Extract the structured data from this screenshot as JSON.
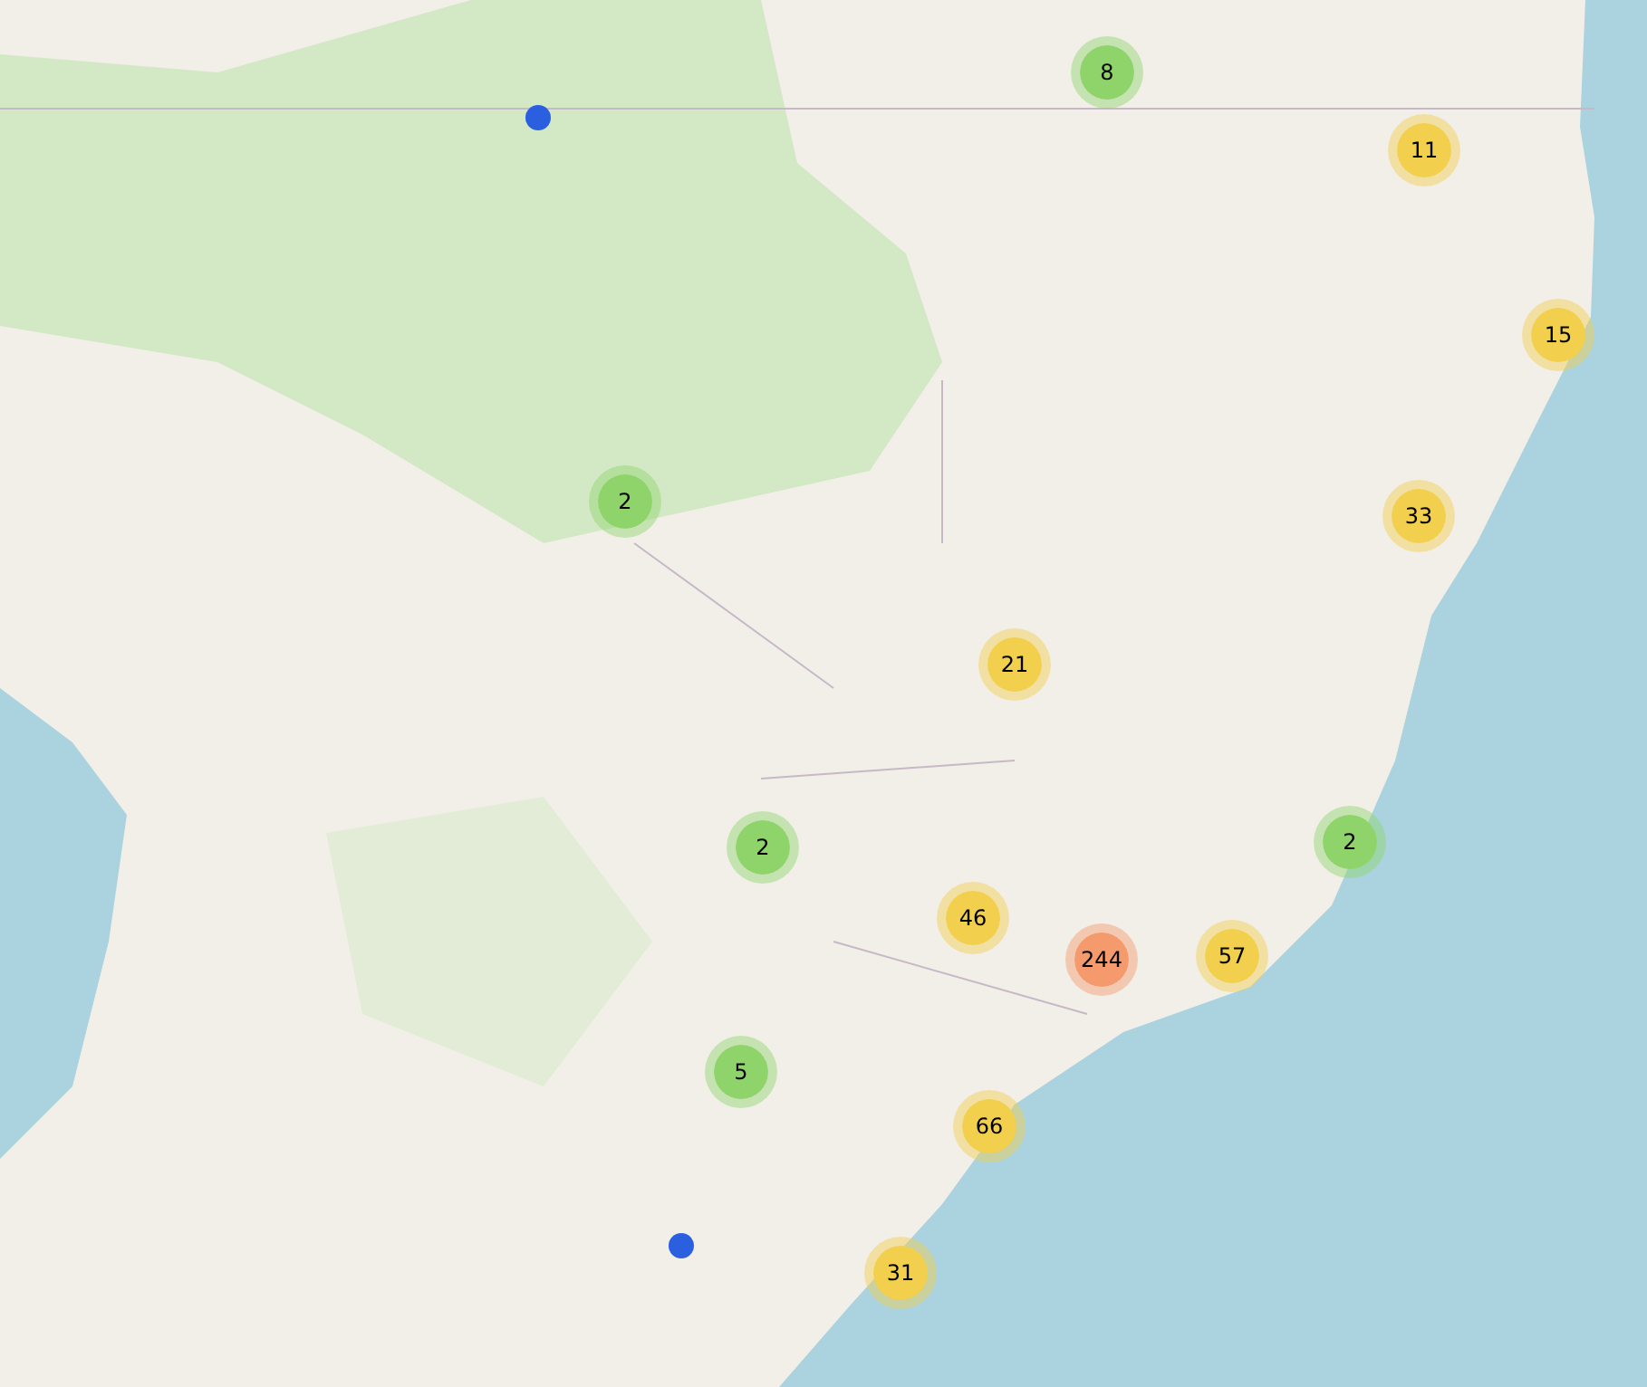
{
  "map": {
    "markers": [
      {
        "kind": "cluster",
        "count": "8",
        "color": "#8fd46b"
      },
      {
        "kind": "cluster",
        "count": "11",
        "color": "#f2cf4c"
      },
      {
        "kind": "cluster",
        "count": "15",
        "color": "#f2cf4c"
      },
      {
        "kind": "cluster",
        "count": "2",
        "color": "#8fd46b"
      },
      {
        "kind": "cluster",
        "count": "33",
        "color": "#f2cf4c"
      },
      {
        "kind": "cluster",
        "count": "21",
        "color": "#f2cf4c"
      },
      {
        "kind": "cluster",
        "count": "2",
        "color": "#8fd46b"
      },
      {
        "kind": "cluster",
        "count": "2",
        "color": "#8fd46b"
      },
      {
        "kind": "cluster",
        "count": "46",
        "color": "#f2cf4c"
      },
      {
        "kind": "cluster",
        "count": "244",
        "color": "#f59a6c"
      },
      {
        "kind": "cluster",
        "count": "57",
        "color": "#f2cf4c"
      },
      {
        "kind": "cluster",
        "count": "5",
        "color": "#8fd46b"
      },
      {
        "kind": "cluster",
        "count": "66",
        "color": "#f2cf4c"
      },
      {
        "kind": "cluster",
        "count": "31",
        "color": "#f2cf4c"
      },
      {
        "kind": "point",
        "color": "#2a5fe0"
      },
      {
        "kind": "point",
        "color": "#2a5fe0"
      }
    ]
  }
}
